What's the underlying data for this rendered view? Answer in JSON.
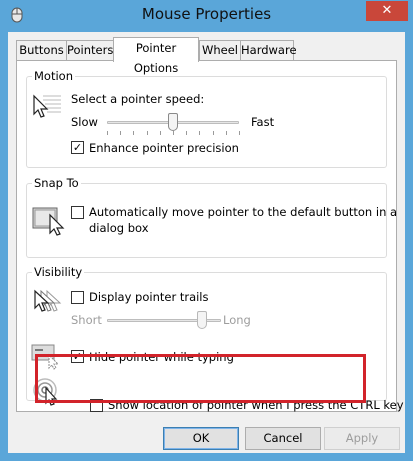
{
  "window": {
    "title": "Mouse Properties",
    "close_glyph": "✕"
  },
  "tabs": [
    {
      "label": "Buttons",
      "active": false
    },
    {
      "label": "Pointers",
      "active": false
    },
    {
      "label": "Pointer Options",
      "active": true
    },
    {
      "label": "Wheel",
      "active": false
    },
    {
      "label": "Hardware",
      "active": false
    }
  ],
  "motion": {
    "group_label": "Motion",
    "speed_label": "Select a pointer speed:",
    "slow_label": "Slow",
    "fast_label": "Fast",
    "speed_value": 6,
    "speed_max": 11,
    "precision_label": "Enhance pointer precision",
    "precision_checked": true
  },
  "snap_to": {
    "group_label": "Snap To",
    "snap_label_line1": "Automatically move pointer to the default button in a",
    "snap_label_line2": "dialog box",
    "snap_checked": false
  },
  "visibility": {
    "group_label": "Visibility",
    "trails_label": "Display pointer trails",
    "trails_checked": false,
    "short_label": "Short",
    "long_label": "Long",
    "trails_length_value": 5,
    "trails_length_max": 6,
    "hide_label": "Hide pointer while typing",
    "hide_checked": true,
    "ctrl_label": "Show location of pointer when I press the CTRL key",
    "ctrl_checked": false
  },
  "buttons": {
    "ok": "OK",
    "cancel": "Cancel",
    "apply": "Apply"
  },
  "colors": {
    "highlight_border": "#d2232a",
    "titlebar": "#5aa6d9",
    "close_button": "#c9473a"
  },
  "icons": {
    "title": "mouse-icon",
    "motion": "pointer-speed-icon",
    "snap": "snap-to-button-icon",
    "trails": "pointer-trails-icon",
    "hide": "hide-pointer-icon",
    "ctrl": "pointer-location-icon"
  }
}
